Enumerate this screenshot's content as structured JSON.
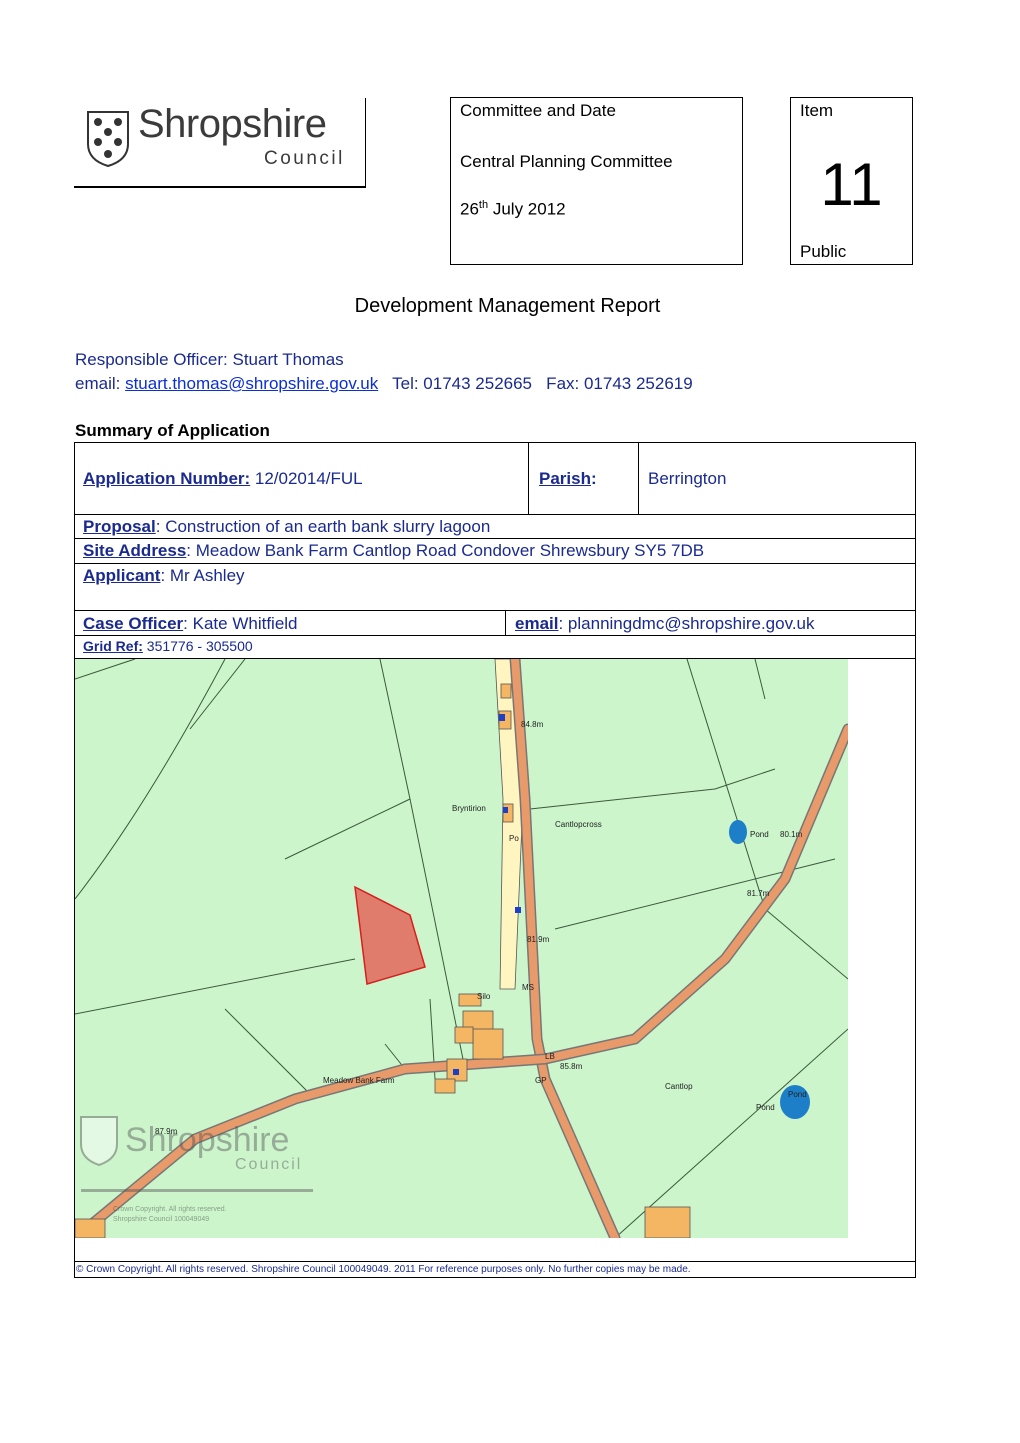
{
  "logo": {
    "word": "Shropshire",
    "sub": "Council"
  },
  "committee": {
    "label": "Committee and Date",
    "name": "Central Planning Committee",
    "date_day": "26",
    "date_sup": "th",
    "date_rest": " July 2012"
  },
  "item": {
    "label": "Item",
    "number": "11",
    "status": "Public"
  },
  "title": "Development Management Report",
  "officer": {
    "line": "Responsible Officer: Stuart Thomas",
    "email_label": "email: ",
    "email": "stuart.thomas@shropshire.gov.uk",
    "tel_fax": "   Tel: 01743 252665   Fax: 01743 252619"
  },
  "summary_heading": "Summary of Application",
  "application": {
    "number_label": "Application Number:",
    "number": " 12/02014/FUL",
    "parish_label": "Parish",
    "parish_colon": ":",
    "parish": "Berrington",
    "proposal_label": "Proposal",
    "proposal": ": Construction of an earth bank slurry lagoon",
    "site_label": "Site Address",
    "site": ": Meadow Bank Farm  Cantlop Road Condover Shrewsbury SY5 7DB",
    "applicant_label": "Applicant",
    "applicant": ": Mr Ashley",
    "case_officer_label": "Case Officer",
    "case_officer": ": Kate Whitfield",
    "email_label": "email",
    "email": ": planningdmc@shropshire.gov.uk",
    "grid_label": "Grid Ref:",
    "grid": " 351776 - 305500"
  },
  "map": {
    "labels": {
      "height1": "84.8m",
      "bryntirion": "Bryntirion",
      "cantlopcross": "Cantlopcross",
      "pond1": "Pond",
      "height2": "80.1m",
      "po": "Po",
      "height3": "81.7m",
      "height4": "81.9m",
      "silo": "Silo",
      "ms": "MS",
      "lb": "LB",
      "height5": "85.8m",
      "gp": "GP",
      "meadowbank": "Meadow Bank Farm",
      "cantlop": "Cantlop",
      "pond2": "Pond",
      "pond3": "Pond",
      "height6": "87.9m",
      "watermark_word": "Shropshire",
      "watermark_sub": "Council",
      "crown1": "Crown Copyright. All rights reserved.",
      "crown2": "Shropshire Council 100049049"
    },
    "colors": {
      "field": "#ccf5cc",
      "road": "#e89a6a",
      "building": "#f5b663",
      "site": "#e07c6c",
      "water": "#1c7fc8",
      "lane": "#fff5c0"
    }
  },
  "footnote": "© Crown Copyright. All rights reserved.  Shropshire Council 100049049. 2011 For reference purposes only. No further copies may be made."
}
